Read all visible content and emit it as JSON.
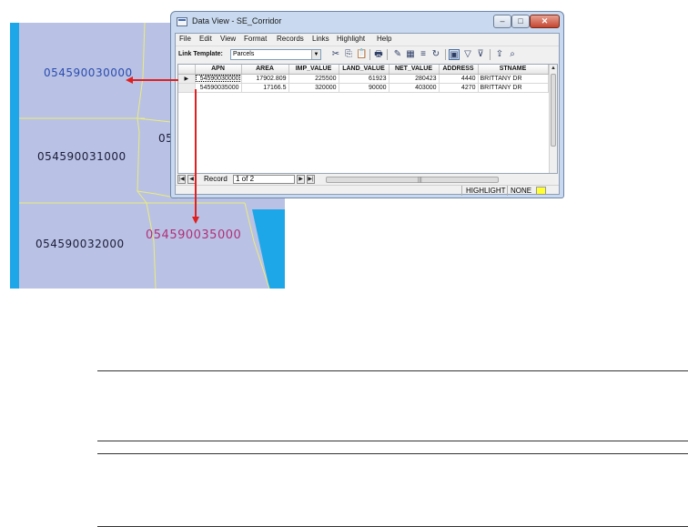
{
  "window": {
    "title": "Data View - SE_Corridor",
    "min_glyph": "–",
    "max_glyph": "□",
    "close_glyph": "✕"
  },
  "menu": [
    "File",
    "Edit",
    "View",
    "Format",
    "Records",
    "Links",
    "Highlight",
    "Help"
  ],
  "toolbar": {
    "link_template_label": "Link Template:",
    "link_template_value": "Parcels",
    "tools": [
      {
        "name": "cut-icon",
        "glyph": "✂"
      },
      {
        "name": "copy-icon",
        "glyph": "⎘"
      },
      {
        "name": "paste-icon",
        "glyph": "📋"
      },
      {
        "name": "print-icon",
        "glyph": "🖶"
      },
      {
        "name": "highlight-icon",
        "glyph": "✎"
      },
      {
        "name": "table-select-icon",
        "glyph": "▦"
      },
      {
        "name": "records-icon",
        "glyph": "≡"
      },
      {
        "name": "refresh-icon",
        "glyph": "↻"
      },
      {
        "name": "select-icon",
        "glyph": "▣"
      },
      {
        "name": "filter-icon",
        "glyph": "▽"
      },
      {
        "name": "filter-clear-icon",
        "glyph": "⊽"
      },
      {
        "name": "export-icon",
        "glyph": "⇪"
      },
      {
        "name": "zoom-to-icon",
        "glyph": "⌕"
      }
    ]
  },
  "grid": {
    "columns": [
      "APN",
      "AREA",
      "IMP_VALUE",
      "LAND_VALUE",
      "NET_VALUE",
      "ADDRESS",
      "STNAME"
    ],
    "rows": [
      [
        "54590030000",
        "17902.809",
        "225500",
        "61923",
        "280423",
        "4440",
        "BRITTANY DR"
      ],
      [
        "54590035000",
        "17166.5",
        "320000",
        "90000",
        "403000",
        "4270",
        "BRITTANY DR"
      ]
    ],
    "current_row_glyph": "▶",
    "scroll_up_glyph": "▲"
  },
  "navigation": {
    "first_glyph": "|◀",
    "prev_glyph": "◀",
    "next_glyph": "▶",
    "last_glyph": "▶|",
    "record_label": "Record",
    "record_value": "1 of 2",
    "hscroll_grip": "|||"
  },
  "status": {
    "highlight_label": "HIGHLIGHT",
    "highlight_value": "NONE",
    "highlight_color": "#ffff33"
  },
  "map": {
    "background": "#b9c2e4",
    "parcel_labels": [
      "054590030000",
      "054590031000",
      "054590032000",
      "054590035000",
      "05"
    ],
    "arrow_color": "#e02020"
  }
}
